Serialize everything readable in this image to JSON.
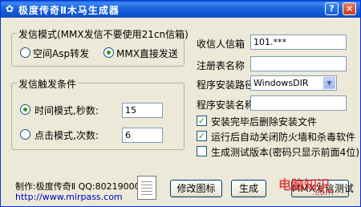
{
  "window": {
    "title": "极度传奇Ⅱ木马生成器",
    "help_label": "?",
    "close_label": "×"
  },
  "send_mode": {
    "legend": "发信模式(MMX发信不要使用21cn信箱)",
    "option_asp": "空间Asp转发",
    "option_mmx": "MMX直接发送",
    "selected": "option_mmx"
  },
  "trigger": {
    "legend": "发信触发条件",
    "time_mode_label": "时间模式,秒数:",
    "time_mode_value": "15",
    "click_mode_label": "点击模式,次数:",
    "click_mode_value": "6",
    "selected": "time_mode"
  },
  "form": {
    "recipient_label": "收信人信箱",
    "recipient_value": "101.***",
    "registry_label": "注册表名称",
    "registry_value": "",
    "install_path_label": "程序安装路径",
    "install_path_value": "WindowsDIR",
    "install_name_label": "程序安装名称",
    "install_name_value": ""
  },
  "options": [
    {
      "label": "安装完毕后删除安装文件",
      "checked": true
    },
    {
      "label": "运行后自动关闭防火墙和杀毒软件",
      "checked": true
    },
    {
      "label": "生成测试版本(密码只显示前面4位)",
      "checked": false
    }
  ],
  "footer": {
    "author": "制作:极度传奇Ⅱ  QQ:80219000",
    "url": "http://www.mirpass.com",
    "change_icon_button": "修改图标",
    "generate_button": "生成",
    "mmx_test_button": "MMX发信测试"
  },
  "watermark": {
    "text": "电脑知识",
    "url": ".com"
  }
}
